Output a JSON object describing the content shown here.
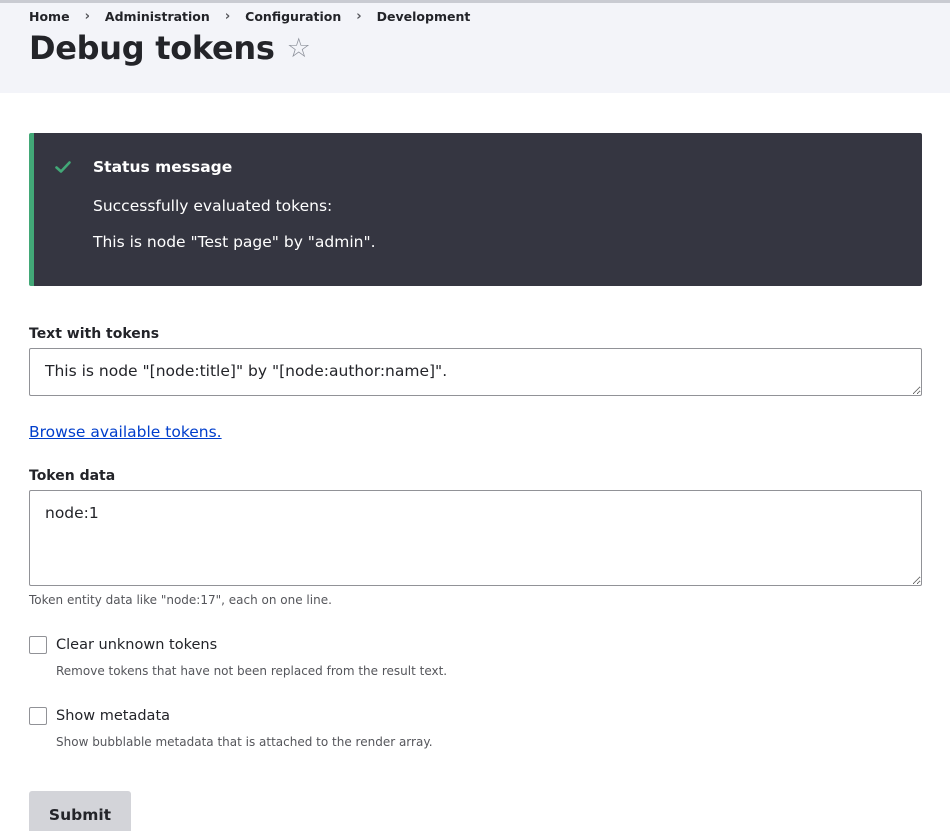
{
  "breadcrumb": [
    "Home",
    "Administration",
    "Configuration",
    "Development"
  ],
  "breadcrumb_separator": "›",
  "page_title": "Debug tokens",
  "favorite_icon": "star-outline-icon",
  "status": {
    "title": "Status message",
    "line1": "Successfully evaluated tokens:",
    "line2": "This is node \"Test page\" by \"admin\".",
    "icon": "check-icon",
    "accent_color": "#42a877"
  },
  "form": {
    "text_with_tokens": {
      "label": "Text with tokens",
      "value": "This is node \"[node:title]\" by \"[node:author:name]\"."
    },
    "browse_link": "Browse available tokens.",
    "token_data": {
      "label": "Token data",
      "value": "node:1",
      "description": "Token entity data like \"node:17\", each on one line."
    },
    "clear_unknown": {
      "label": "Clear unknown tokens",
      "description": "Remove tokens that have not been replaced from the result text.",
      "checked": false
    },
    "show_metadata": {
      "label": "Show metadata",
      "description": "Show bubblable metadata that is attached to the render array.",
      "checked": false
    },
    "submit_label": "Submit"
  },
  "colors": {
    "header_bg": "#f3f4f9",
    "status_bg": "#353641",
    "link": "#003ecc",
    "button_bg": "#d3d4d9"
  }
}
